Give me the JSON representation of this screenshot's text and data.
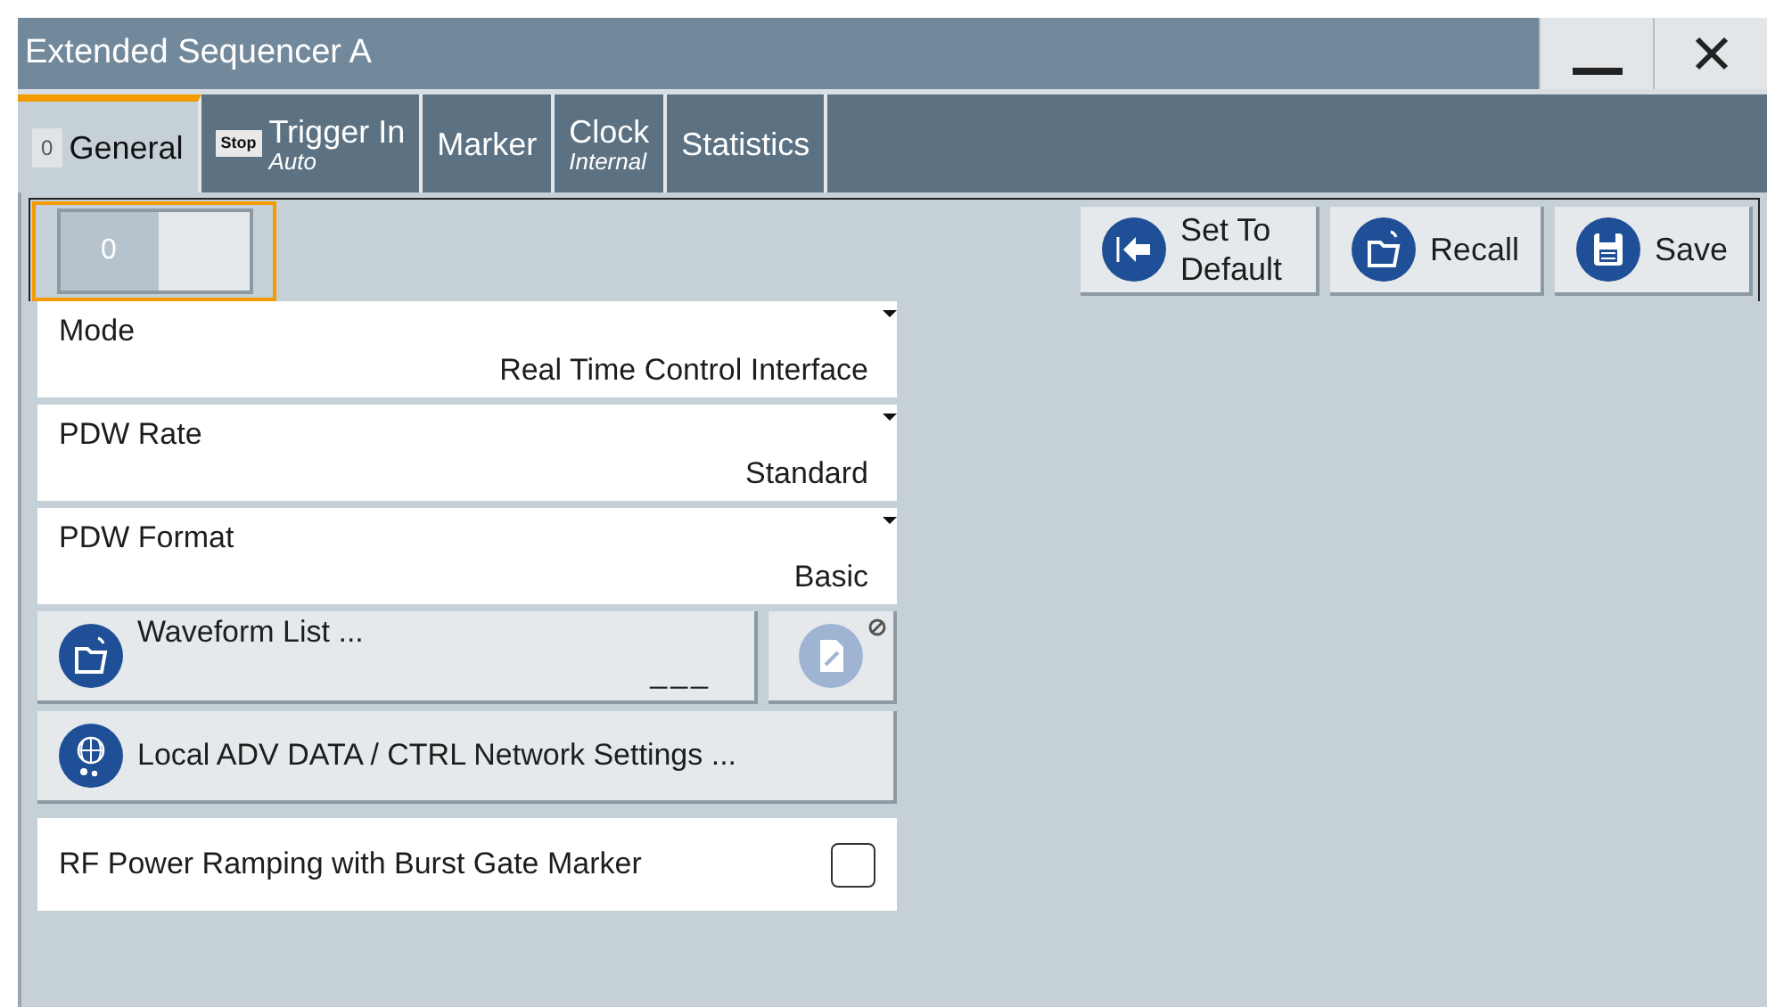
{
  "window": {
    "title": "Extended Sequencer A",
    "controls": [
      {
        "kind": "minimize"
      },
      {
        "kind": "close"
      }
    ]
  },
  "tabs": [
    {
      "label": "General",
      "badge": {
        "kind": "state",
        "text": "0"
      },
      "selected": true
    },
    {
      "label": "Trigger In",
      "badge": {
        "kind": "stop",
        "text": "Stop"
      },
      "subtitle": "Auto",
      "selected": false
    },
    {
      "label": "Marker",
      "selected": false
    },
    {
      "label": "Clock",
      "subtitle": "Internal",
      "selected": false
    },
    {
      "label": "Statistics",
      "selected": false
    }
  ],
  "state_switch": {
    "label": "0",
    "on": false
  },
  "toolbar_buttons": [
    {
      "kind": "default",
      "label": "Set To Default"
    },
    {
      "kind": "recall",
      "label": "Recall"
    },
    {
      "kind": "save",
      "label": "Save"
    }
  ],
  "settings": [
    {
      "kind": "dropdown",
      "label": "Mode",
      "value": "Real Time Control Interface"
    },
    {
      "kind": "dropdown",
      "label": "PDW Rate",
      "value": "Standard"
    },
    {
      "kind": "dropdown",
      "label": "PDW Format",
      "value": "Basic"
    },
    {
      "kind": "file",
      "label": "Waveform List ...",
      "file_name": "___",
      "edit_disabled": true
    },
    {
      "kind": "network",
      "label": "Local ADV DATA / CTRL Network Settings ..."
    },
    {
      "kind": "checkbox",
      "label": "RF Power Ramping with Burst Gate Marker",
      "checked": false
    }
  ]
}
